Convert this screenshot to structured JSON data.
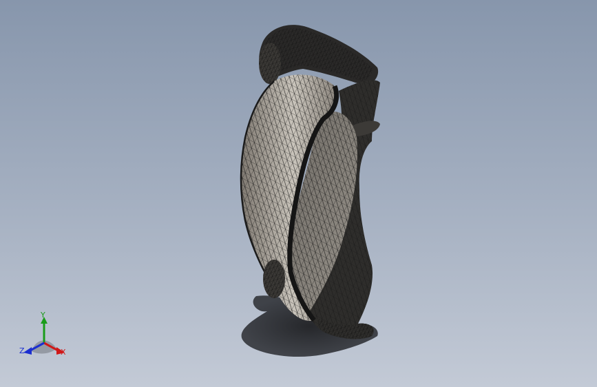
{
  "viewport": {
    "background_top": "#8796ac",
    "background_bottom": "#c3cad6"
  },
  "model": {
    "display_mode": "mesh-wireframe",
    "surface_color": "#9c968e",
    "edge_color": "#111111",
    "shadow": true
  },
  "triad": {
    "y_label": "Y",
    "x_label": "X",
    "z_label": "Z",
    "colors": {
      "x": "#d01818",
      "y": "#1a9c1a",
      "z": "#1a2ed0"
    }
  }
}
